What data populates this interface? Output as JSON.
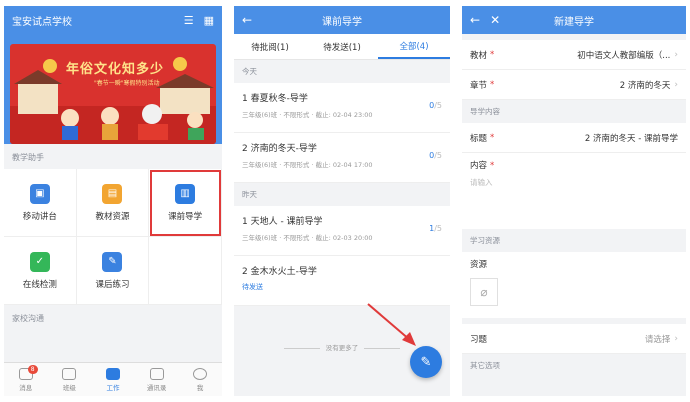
{
  "screen1": {
    "school_name": "宝安试点学校",
    "banner_title": "年俗文化知多少",
    "banner_subtitle": "\"春节一瞬\"寒假特别活动",
    "section_teaching": "教学助手",
    "tiles": [
      {
        "label": "移动讲台",
        "icon": "podium-icon",
        "color": "#3b82e0"
      },
      {
        "label": "教材资源",
        "icon": "book-icon",
        "color": "#f2a531"
      },
      {
        "label": "课前导学",
        "icon": "guide-icon",
        "color": "#2d7ce0"
      },
      {
        "label": "在线检测",
        "icon": "check-icon",
        "color": "#34b759"
      },
      {
        "label": "课后练习",
        "icon": "exercise-icon",
        "color": "#3b82e0"
      }
    ],
    "section_home_school": "家校沟通",
    "tabbar": [
      {
        "label": "消息",
        "badge": "8"
      },
      {
        "label": "班级",
        "badge": ""
      },
      {
        "label": "工作",
        "badge": ""
      },
      {
        "label": "通讯录",
        "badge": ""
      },
      {
        "label": "我",
        "badge": ""
      }
    ],
    "active_tab": "工作"
  },
  "screen2": {
    "title": "课前导学",
    "tabs": [
      "待批阅(1)",
      "待发送(1)",
      "全部(4)"
    ],
    "active_tab": "全部(4)",
    "today_label": "今天",
    "yesterday_label": "昨天",
    "items": [
      {
        "name": "1 春夏秋冬-导学",
        "meta": "三年级(6)班 · 不限形式 · 截止: 02-04 23:00",
        "done": "0",
        "total": "/5"
      },
      {
        "name": "2 济南的冬天-导学",
        "meta": "三年级(6)班 · 不限形式 · 截止: 02-04 17:00",
        "done": "0",
        "total": "/5"
      },
      {
        "name": "1 天地人 - 课前导学",
        "meta": "三年级(6)班 · 不限形式 · 截止: 02-03 20:00",
        "done": "1",
        "total": "/5"
      },
      {
        "name": "2 金木水火土-导学",
        "status": "待发送"
      }
    ],
    "no_more": "没有更多了"
  },
  "screen3": {
    "title": "新建导学",
    "textbook_label": "教材",
    "textbook_value": "初中语文人教部编版（...",
    "chapter_label": "章节",
    "chapter_value": "2 济南的冬天",
    "content_group": "导学内容",
    "title_label": "标题",
    "title_value": "2 济南的冬天 - 课前导学",
    "content_label": "内容",
    "content_placeholder": "请输入",
    "resource_group": "学习资源",
    "resource_label": "资源",
    "exercise_label": "习题",
    "exercise_value": "请选择",
    "other_group": "其它选项"
  },
  "colors": {
    "primary": "#4a8fe6",
    "accent": "#2d7ce0",
    "highlight": "#e03a3a"
  }
}
